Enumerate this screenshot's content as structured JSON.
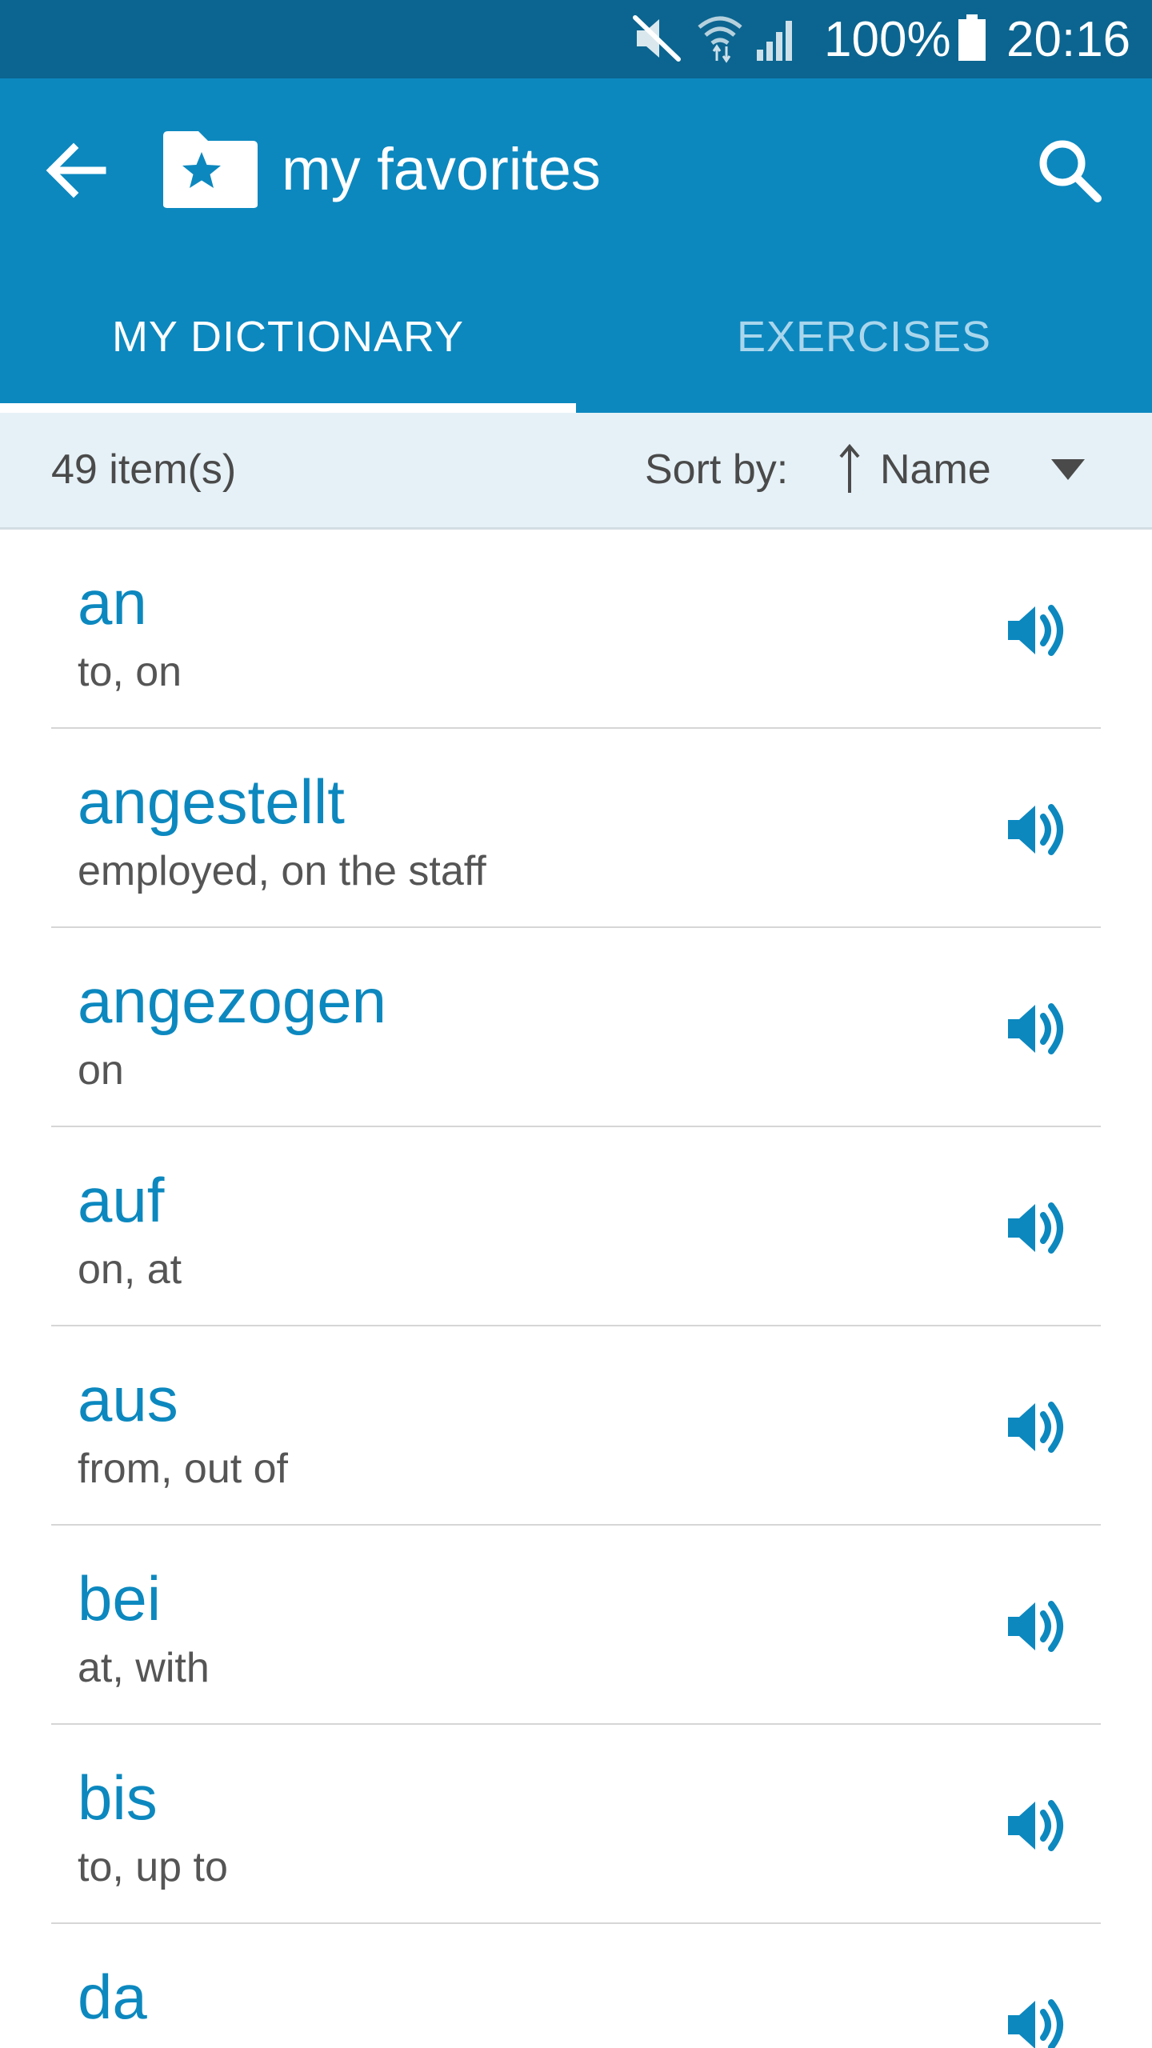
{
  "status_bar": {
    "battery_percent": "100%",
    "time": "20:16",
    "icons": [
      "mute-icon",
      "wifi-icon",
      "signal-icon",
      "battery-icon"
    ]
  },
  "app_bar": {
    "title": "my favorites",
    "icons": [
      "back-arrow-icon",
      "favorites-folder-icon",
      "search-icon"
    ],
    "accent_color": "#0c88bf",
    "status_bar_color": "#0b6590"
  },
  "tabs": [
    {
      "label": "MY DICTIONARY",
      "selected": true
    },
    {
      "label": "EXERCISES",
      "selected": false
    }
  ],
  "sort_bar": {
    "item_count": "49 item(s)",
    "sort_label": "Sort by:",
    "sort_value": "Name",
    "sort_direction": "ascending"
  },
  "entries": [
    {
      "word": "an",
      "meaning": "to, on"
    },
    {
      "word": "angestellt",
      "meaning": "employed, on the staff"
    },
    {
      "word": "angezogen",
      "meaning": "on"
    },
    {
      "word": "auf",
      "meaning": "on, at"
    },
    {
      "word": "aus",
      "meaning": "from, out of"
    },
    {
      "word": "bei",
      "meaning": "at, with"
    },
    {
      "word": "bis",
      "meaning": "to, up to"
    },
    {
      "word": "da",
      "meaning": ""
    }
  ]
}
